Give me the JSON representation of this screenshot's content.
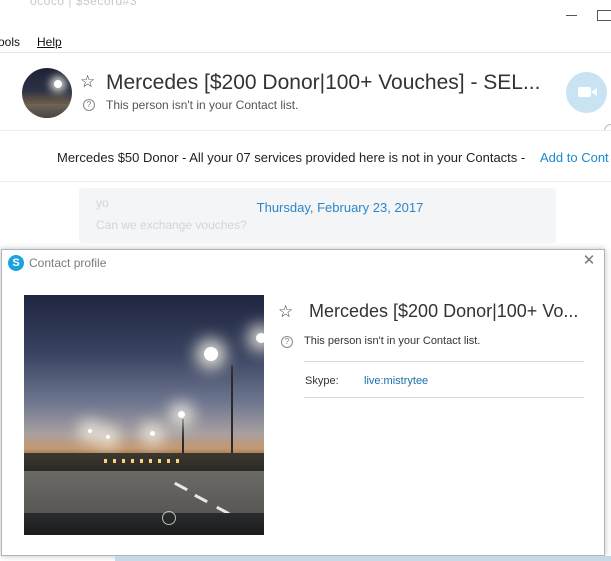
{
  "window": {
    "ghost_title": "ococo | $5ecord#3"
  },
  "menu": {
    "tools": "ools",
    "help": "Help"
  },
  "conversation": {
    "name": "Mercedes [$200 Donor|100+ Vouches] - SEL...",
    "status": "This person isn't in your Contact list."
  },
  "notice": {
    "text": "Mercedes $50 Donor - All your 07 services provided here is not in your Contacts - ",
    "link": "Add to Cont"
  },
  "chat": {
    "date": "Thursday, February 23, 2017",
    "msg1": "yo",
    "msg2": "Can we exchange vouches?"
  },
  "profile": {
    "title": "Contact profile",
    "name": "Mercedes [$200 Donor|100+ Vo...",
    "status": "This person isn't in your Contact list.",
    "skype_label": "Skype:",
    "skype_value": "live:mistrytee"
  },
  "icons": {
    "star": "star-icon",
    "help": "question-circle-icon",
    "video": "video-camera-icon",
    "close": "close-icon",
    "skype": "skype-logo-icon"
  },
  "colors": {
    "link": "#1a8ad1",
    "skype_blue": "#1aa3e0",
    "video_button": "#c9e3f3"
  }
}
